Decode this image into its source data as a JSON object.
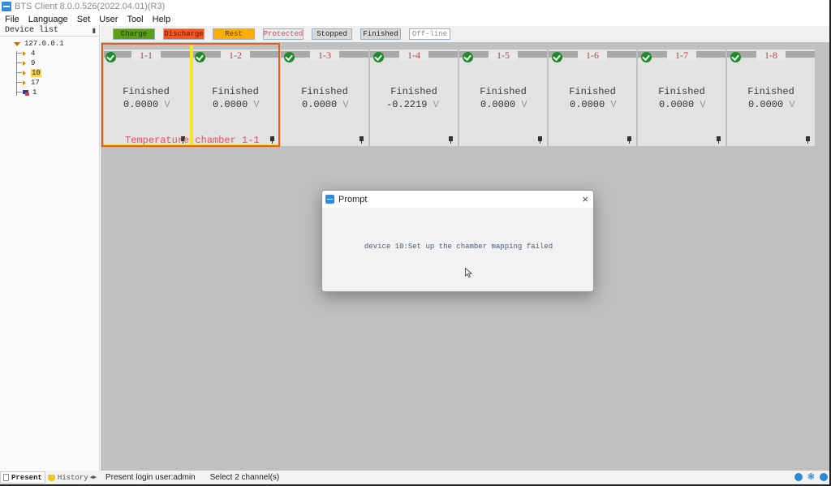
{
  "window": {
    "title": "BTS Client 8.0.0.526(2022.04.01)(R3)"
  },
  "menu": [
    "File",
    "Language",
    "Set",
    "User",
    "Tool",
    "Help"
  ],
  "sidebar": {
    "title": "Device list",
    "root": "127.0.0.1",
    "devices": [
      {
        "label": "4",
        "state": "online"
      },
      {
        "label": "9",
        "state": "online"
      },
      {
        "label": "10",
        "state": "online",
        "selected": true
      },
      {
        "label": "17",
        "state": "online"
      },
      {
        "label": "1",
        "state": "offline"
      }
    ]
  },
  "legend": {
    "charge": "Charge",
    "discharge": "Discharge",
    "rest": "Rest",
    "protected": "Protected",
    "stopped": "Stopped",
    "finished": "Finished",
    "offline": "Off-line",
    "colors": {
      "charge": "#5e9e17",
      "discharge": "#f25a22",
      "rest": "#f9ae08"
    }
  },
  "channels": [
    {
      "id": "1-1",
      "status": "Finished",
      "voltage": "0.0000",
      "unit": "V",
      "selected": true
    },
    {
      "id": "1-2",
      "status": "Finished",
      "voltage": "0.0000",
      "unit": "V",
      "selected": true
    },
    {
      "id": "1-3",
      "status": "Finished",
      "voltage": "0.0000",
      "unit": "V"
    },
    {
      "id": "1-4",
      "status": "Finished",
      "voltage": "-0.2219",
      "unit": "V"
    },
    {
      "id": "1-5",
      "status": "Finished",
      "voltage": "0.0000",
      "unit": "V"
    },
    {
      "id": "1-6",
      "status": "Finished",
      "voltage": "0.0000",
      "unit": "V"
    },
    {
      "id": "1-7",
      "status": "Finished",
      "voltage": "0.0000",
      "unit": "V"
    },
    {
      "id": "1-8",
      "status": "Finished",
      "voltage": "0.0000",
      "unit": "V"
    }
  ],
  "chamber": {
    "label": "Temperature chamber 1-1"
  },
  "dialog": {
    "title": "Prompt",
    "close": "×",
    "message": "device 10:Set up the chamber mapping failed"
  },
  "statusbar": {
    "tabs": {
      "present": "Present",
      "history": "History"
    },
    "login": "Present login user:admin",
    "selection": "Select 2 channel(s)"
  }
}
